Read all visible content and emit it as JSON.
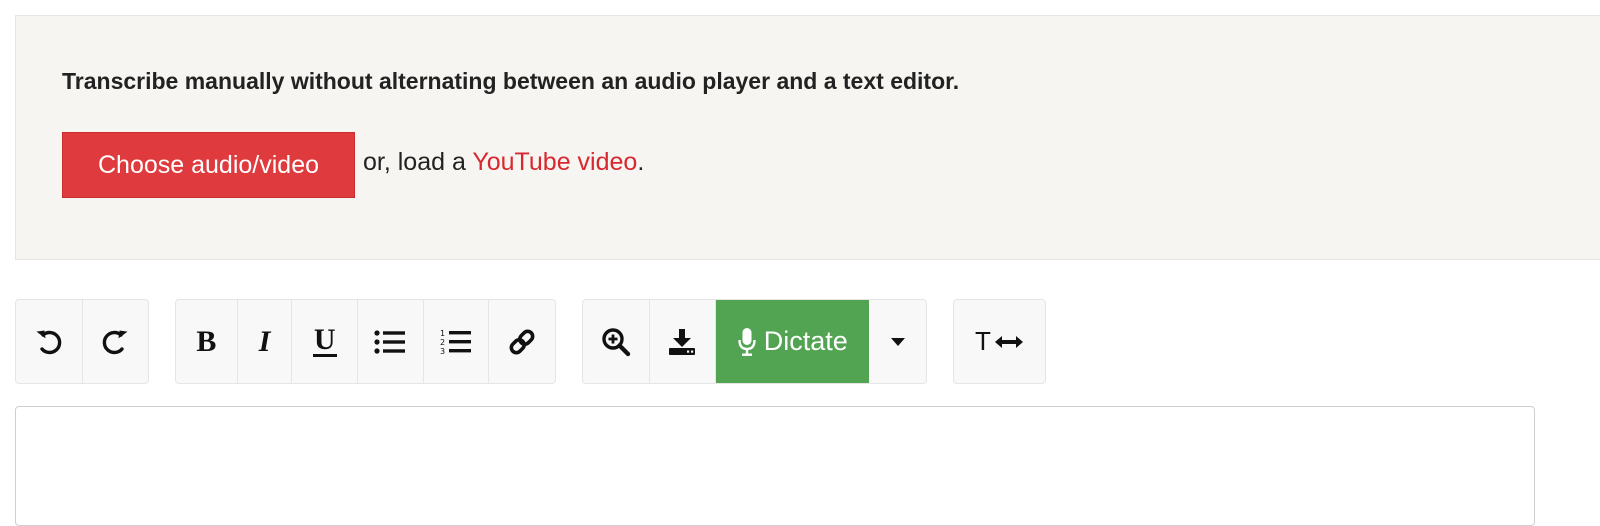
{
  "intro": {
    "description": "Transcribe manually without alternating between an audio player and a text editor.",
    "choose_button": "Choose audio/video",
    "alt_prefix": "or, load a",
    "youtube_link": "YouTube video",
    "alt_suffix": "."
  },
  "toolbar": {
    "history": [
      {
        "name": "undo",
        "icon": "undo-icon"
      },
      {
        "name": "redo",
        "icon": "redo-icon"
      }
    ],
    "formatting": [
      {
        "name": "bold",
        "glyph": "B"
      },
      {
        "name": "italic",
        "glyph": "I"
      },
      {
        "name": "underline",
        "glyph": "U"
      },
      {
        "name": "bullet-list",
        "icon": "bullet-list-icon"
      },
      {
        "name": "numbered-list",
        "icon": "numbered-list-icon"
      },
      {
        "name": "link",
        "icon": "link-icon"
      }
    ],
    "media": {
      "zoom_icon": "zoom-in-icon",
      "download_icon": "download-icon",
      "dictate_label": "Dictate",
      "dictate_icon": "microphone-icon",
      "dropdown_icon": "caret-down-icon"
    },
    "text_width": {
      "glyph": "T",
      "icon": "width-arrows-icon"
    }
  },
  "colors": {
    "accent_red": "#df3b3e",
    "link_red": "#d8282f",
    "dictate_green": "#52a452",
    "panel_bg": "#f6f5f1"
  },
  "editor": {
    "content": ""
  }
}
